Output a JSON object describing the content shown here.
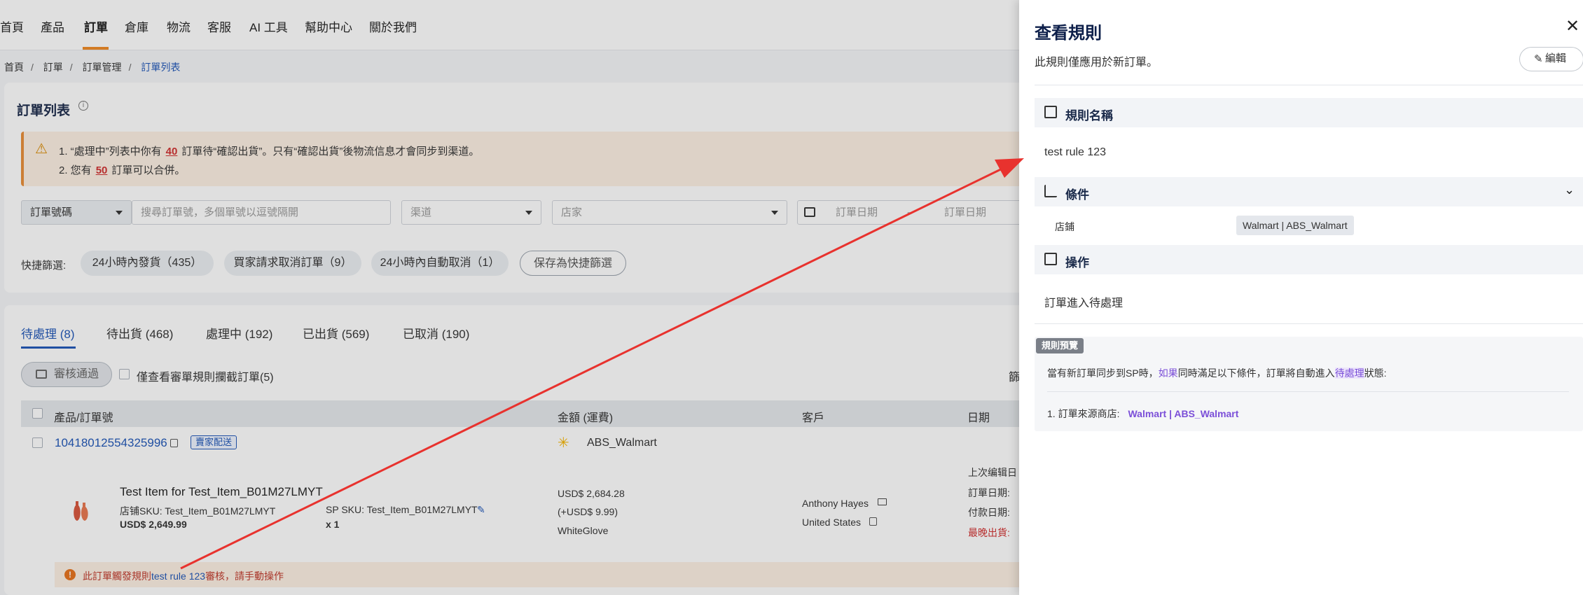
{
  "topnav": {
    "items": [
      "首頁",
      "產品",
      "訂單",
      "倉庫",
      "物流",
      "客服",
      "AI 工具",
      "幫助中心",
      "關於我們"
    ]
  },
  "breadcrumb": [
    "首頁",
    "訂單",
    "訂單管理",
    "訂單列表"
  ],
  "page_title": "訂單列表",
  "alert": {
    "line1_a": "1. “處理中”列表中你有",
    "line1_num": "40",
    "line1_b": "訂單待“確認出貨”。只有“確認出貨”後物流信息才會同步到渠道。",
    "line2_a": "2. 您有",
    "line2_num": "50",
    "line2_b": "訂單可以合併。"
  },
  "filters": {
    "order_type": "訂單號碼",
    "search_placeholder": "搜尋訂單號，多個單號以逗號隔開",
    "channel": "渠道",
    "shop": "店家",
    "date_from": "訂單日期",
    "date_sep": "-",
    "date_to": "訂單日期"
  },
  "quick_filters": {
    "label": "快捷篩選:",
    "chips": [
      "24小時內發貨（435）",
      "買家請求取消訂單（9）",
      "24小時內自動取消（1）"
    ],
    "save": "保存為快捷篩選"
  },
  "tabs": [
    "待處理 (8)",
    "待出貨 (468)",
    "處理中 (192)",
    "已出貨 (569)",
    "已取消 (190)"
  ],
  "toolbar": {
    "approve": "審核通過",
    "only_blocked": "僅查看審單規則攔截訂單(5)",
    "filter_trunc": "篩"
  },
  "table": {
    "headers": [
      "產品/訂單號",
      "金額 (運費)",
      "客戶",
      "日期"
    ]
  },
  "order": {
    "number": "10418012554325996",
    "badge": "賣家配送",
    "store": "ABS_Walmart",
    "product_title": "Test Item for Test_Item_B01M27LMYT",
    "store_sku": "店铺SKU: Test_Item_B01M27LMYT",
    "price": "USD$ 2,649.99",
    "sp_sku": "SP SKU: Test_Item_B01M27LMYT",
    "qty": "x 1",
    "amount": "USD$ 2,684.28",
    "shipping": "(+USD$ 9.99)",
    "carrier": "WhiteGlove",
    "customer": "Anthony Hayes",
    "country": "United States",
    "date_labels": [
      "上次编辑日",
      "訂單日期:",
      "付款日期:",
      "最晚出貨:"
    ],
    "rule_msg_a": "此訂單觸發規則",
    "rule_link": "test rule 123",
    "rule_msg_b": "審核，請手動操作"
  },
  "drawer": {
    "title": "查看規則",
    "subtitle": "此規則僅應用於新訂單。",
    "edit": "編輯",
    "rule_name_label": "規則名稱",
    "rule_name": "test rule 123",
    "condition_label": "條件",
    "condition_key": "店鋪",
    "condition_value": "Walmart | ABS_Walmart",
    "action_label": "操作",
    "action_value": "訂單進入待處理",
    "preview": {
      "badge": "規則預覽",
      "line_a": "當有新訂單同步到SP時，",
      "if": "如果",
      "line_b": "同時滿足以下條件，訂單將自動進入",
      "status": "待處理",
      "line_c": "狀態:",
      "cond_label": "1. 訂單來源商店:",
      "cond_value": "Walmart | ABS_Walmart"
    }
  },
  "colors": {
    "accent_blue": "#1f56b8",
    "nav_active": "#f08a24",
    "annotation_arrow": "#e8322e",
    "preview_purple": "#7b4fd8"
  }
}
